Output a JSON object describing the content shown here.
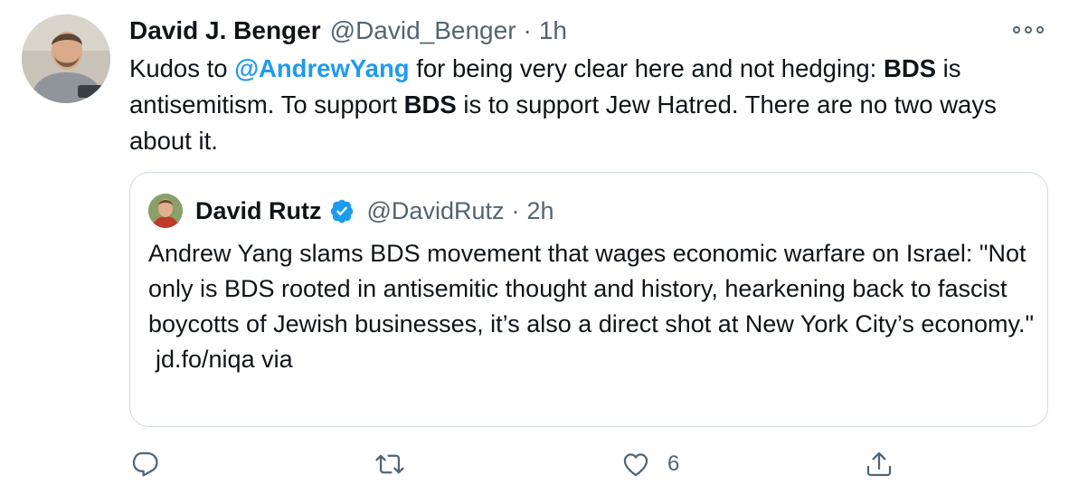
{
  "tweet": {
    "author_name": "David J. Benger",
    "author_handle": "@David_Benger",
    "separator": "·",
    "time": "1h",
    "text": {
      "t1": "Kudos to ",
      "mention": "@AndrewYang",
      "t2": " for being very clear here and not hedging: ",
      "bold1": "BDS",
      "t3": " is antisemitism. To support ",
      "bold2": "BDS",
      "t4": " is to support Jew Hatred. There are no two ways about it."
    }
  },
  "quote": {
    "author_name": "David Rutz",
    "author_handle": "@DavidRutz",
    "separator": "·",
    "time": "2h",
    "text": "Andrew Yang slams BDS movement that wages economic warfare on Israel: \"Not only is BDS rooted in antisemitic thought and history, hearkening back to fascist boycotts of Jewish businesses, it’s also a direct shot at New York City’s economy.\"",
    "link": "jd.fo/niqa via"
  },
  "actions": {
    "like_count": "6"
  },
  "icons": {
    "more": "more-horizontal-icon",
    "verified": "verified-badge-icon",
    "reply": "reply-icon",
    "retweet": "retweet-icon",
    "like": "heart-icon",
    "share": "share-icon"
  },
  "colors": {
    "accent": "#1d9bf0",
    "text": "#0f1419",
    "secondary": "#536471",
    "border": "#cfd9de"
  }
}
